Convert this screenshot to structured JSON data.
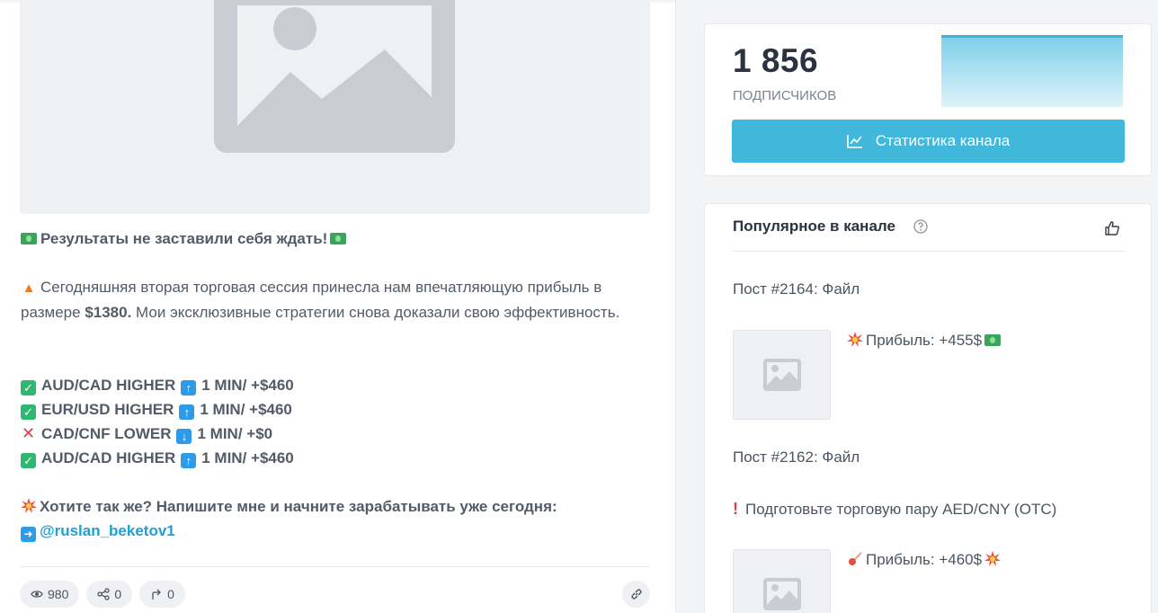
{
  "post": {
    "headline": "Результаты не заставили себя ждать!",
    "para_line1": "Сегодняшняя вторая торговая сессия принесла нам впечатляющую прибыль в",
    "para_line2_start": "размере",
    "para_amount": "$1380.",
    "para_line2_end": "Мои эксклюзивные стратегии снова доказали свою эффективность.",
    "trades": [
      {
        "status": "win",
        "pair": "AUD/CAD HIGHER",
        "direction": "up",
        "result": "1 MIN/ +$460"
      },
      {
        "status": "win",
        "pair": "EUR/USD HIGHER",
        "direction": "up",
        "result": "1 MIN/ +$460"
      },
      {
        "status": "loss",
        "pair": "CAD/CNF LOWER",
        "direction": "down",
        "result": "1 MIN/ +$0"
      },
      {
        "status": "win",
        "pair": "AUD/CAD HIGHER",
        "direction": "up",
        "result": "1 MIN/ +$460"
      }
    ],
    "cta": "Хотите так же? Напишите мне и начните зарабатывать уже сегодня:",
    "handle": "@ruslan_beketov1",
    "views": "980",
    "shares": "0",
    "forwards": "0"
  },
  "subscribers": {
    "count": "1 856",
    "label": "ПОДПИСЧИКОВ",
    "stats_button": "Статистика канала"
  },
  "popular": {
    "title": "Популярное в канале",
    "items": [
      {
        "label": "Пост #2164: Файл",
        "text": "Прибыль: +455$"
      },
      {
        "label": "Пост #2162: Файл",
        "line": "Подготовьте торговую пару AED/CNY (OTC)",
        "text": "Прибыль: +460$"
      }
    ]
  },
  "colors": {
    "accent": "#41b7dc",
    "link": "#1f9fd6",
    "win": "#2eb872",
    "loss": "#e33b50",
    "arrow": "#2e9be8"
  }
}
